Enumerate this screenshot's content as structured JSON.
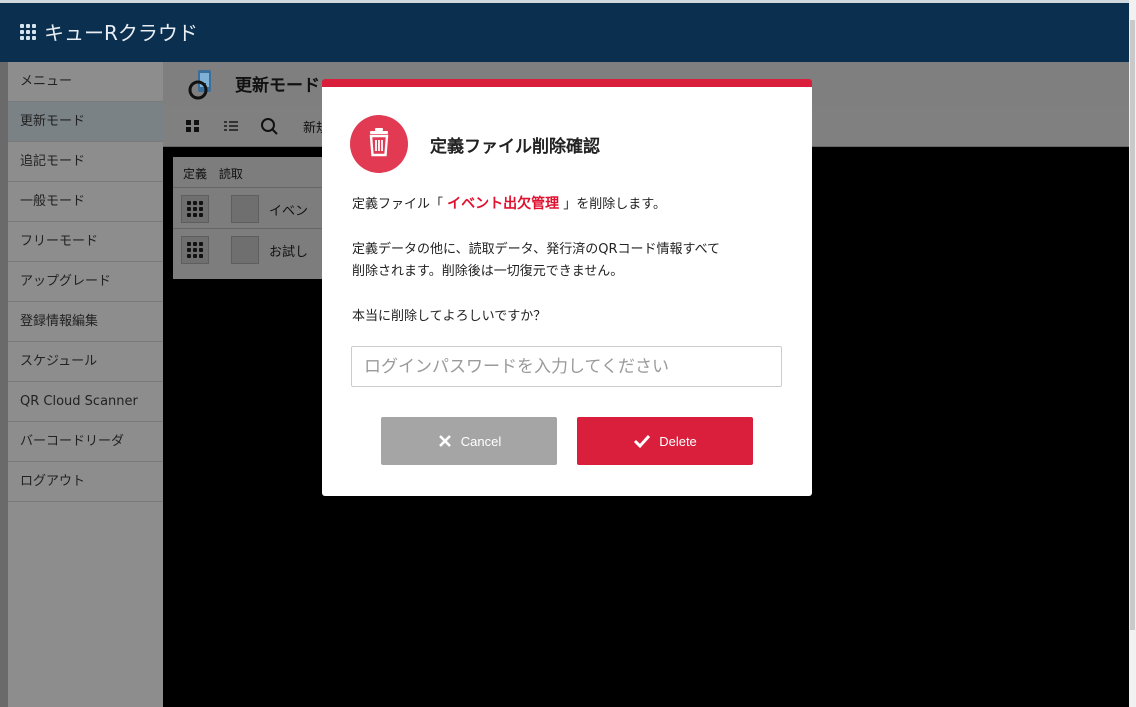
{
  "app": {
    "title": "キューRクラウド"
  },
  "sidebar": {
    "items": [
      {
        "label": "メニュー"
      },
      {
        "label": "更新モード"
      },
      {
        "label": "追記モード"
      },
      {
        "label": "一般モード"
      },
      {
        "label": "フリーモード"
      },
      {
        "label": "アップグレード"
      },
      {
        "label": "登録情報編集"
      },
      {
        "label": "スケジュール"
      },
      {
        "label": "QR Cloud Scanner"
      },
      {
        "label": "バーコードリーダ"
      },
      {
        "label": "ログアウト"
      }
    ],
    "active_index": 1
  },
  "header": {
    "mode_title": "更新モード"
  },
  "toolbar": {
    "new_label": "新規"
  },
  "table": {
    "columns": [
      "定義",
      "読取"
    ],
    "rows": [
      {
        "text": "イベン"
      },
      {
        "text": "お試し"
      }
    ]
  },
  "modal": {
    "title": "定義ファイル削除確認",
    "line1_prefix": "定義ファイル「",
    "line1_name": "イベント出欠管理",
    "line1_suffix": "」を削除します。",
    "line2a": "定義データの他に、読取データ、発行済のQRコード情報すべて",
    "line2b": "削除されます。削除後は一切復元できません。",
    "line3": "本当に削除してよろしいですか？",
    "password_placeholder": "ログインパスワードを入力してください",
    "cancel_label": "Cancel",
    "delete_label": "Delete",
    "accent_color": "#d91f3c"
  },
  "icons": {
    "app": "apps-grid-icon",
    "trash": "trash-icon",
    "cancel": "close-icon",
    "delete": "check-icon"
  }
}
